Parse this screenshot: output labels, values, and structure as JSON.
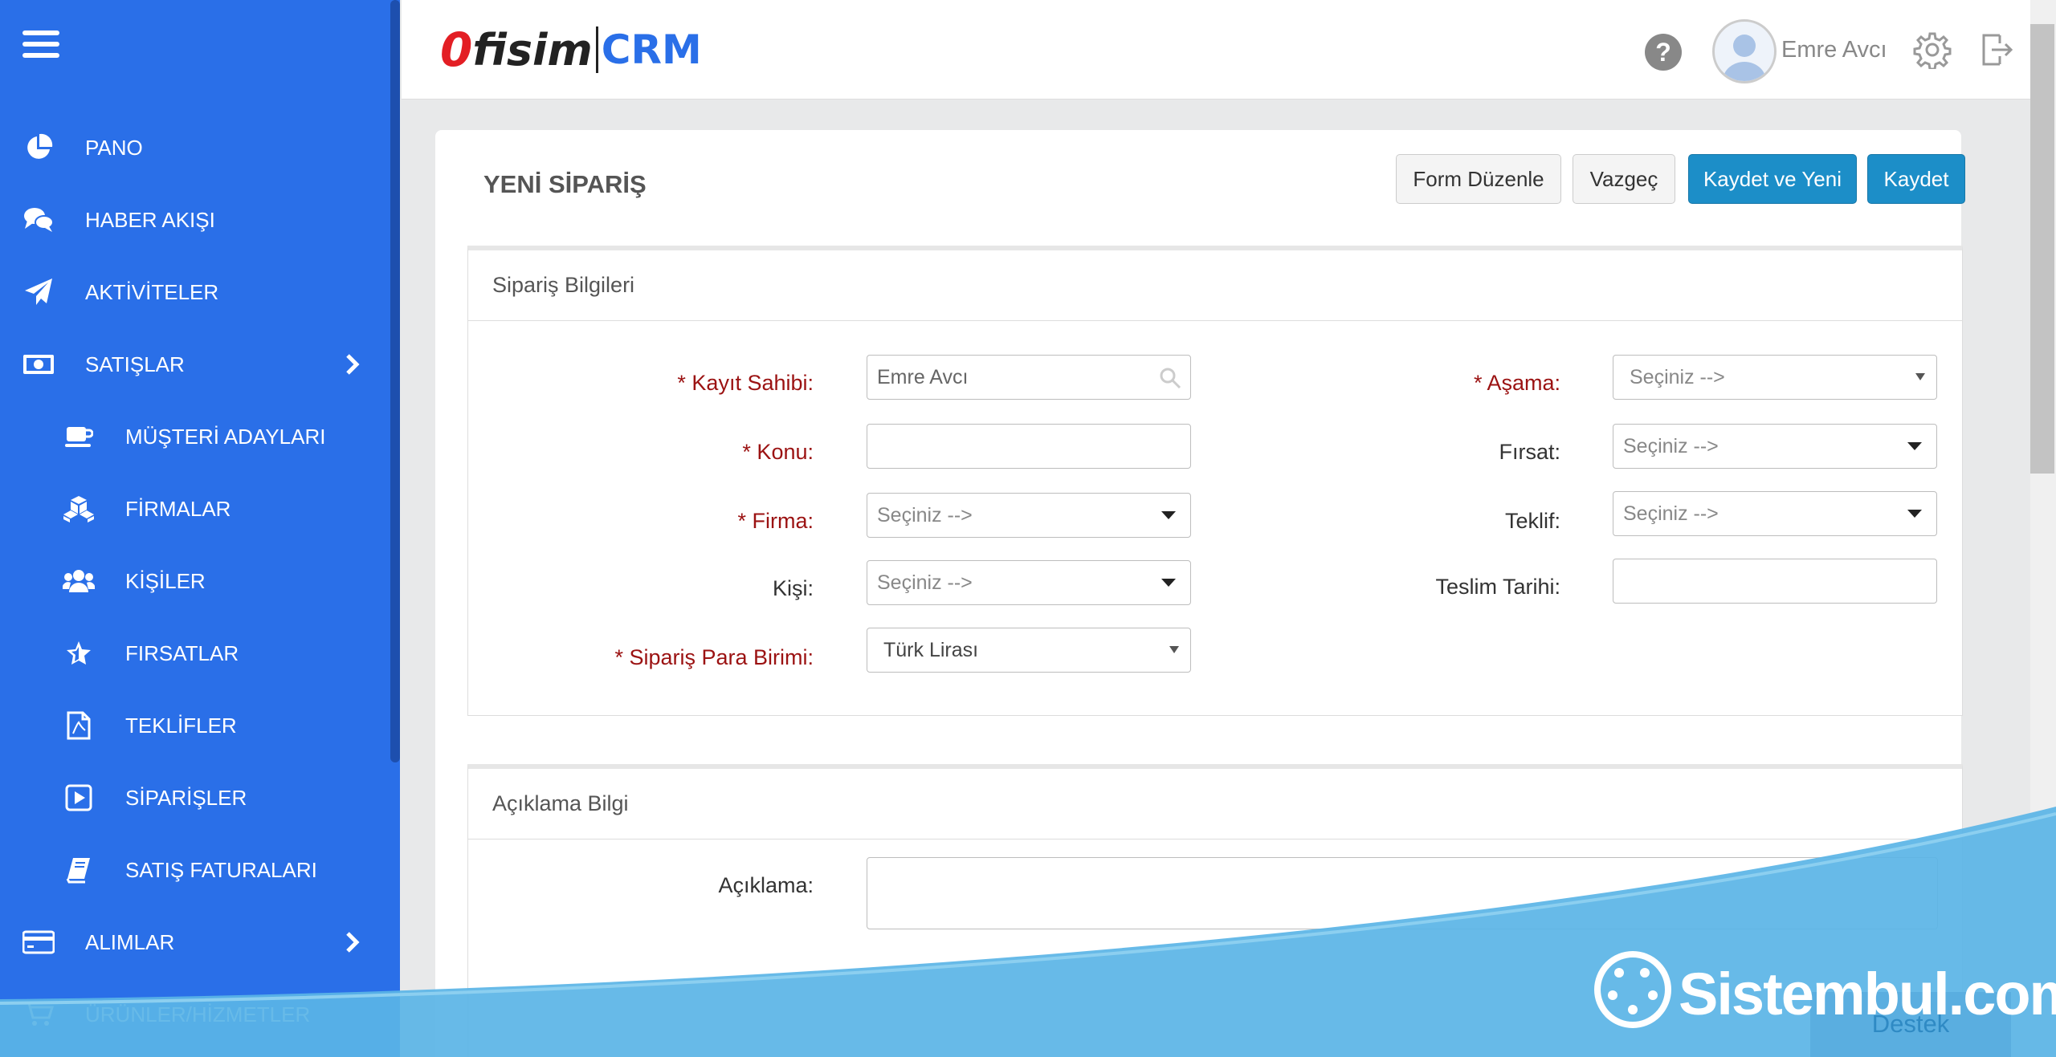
{
  "sidebar": {
    "items": [
      {
        "label": "PANO",
        "icon": "pie-chart-icon"
      },
      {
        "label": "HABER AKIŞI",
        "icon": "chat-icon"
      },
      {
        "label": "AKTİVİTELER",
        "icon": "paper-plane-icon"
      },
      {
        "label": "SATIŞLAR",
        "icon": "money-icon"
      },
      {
        "label": "MÜŞTERİ ADAYLARI",
        "icon": "coffee-icon"
      },
      {
        "label": "FİRMALAR",
        "icon": "cubes-icon"
      },
      {
        "label": "KİŞİLER",
        "icon": "users-icon"
      },
      {
        "label": "FIRSATLAR",
        "icon": "star-icon"
      },
      {
        "label": "TEKLİFLER",
        "icon": "pdf-file-icon"
      },
      {
        "label": "SİPARİŞLER",
        "icon": "play-square-icon"
      },
      {
        "label": "SATIŞ FATURALARI",
        "icon": "book-icon"
      },
      {
        "label": "ALIMLAR",
        "icon": "credit-card-icon"
      },
      {
        "label": "ÜRÜNLER/HİZMETLER",
        "icon": "cart-icon"
      }
    ]
  },
  "header": {
    "logo_part1": "0",
    "logo_part2": "fisim",
    "logo_part3": "CRM",
    "user_name": "Emre Avcı"
  },
  "page": {
    "title": "YENİ SİPARİŞ",
    "buttons": {
      "form_edit": "Form Düzenle",
      "cancel": "Vazgeç",
      "save_new": "Kaydet ve Yeni",
      "save": "Kaydet"
    }
  },
  "order_info": {
    "heading": "Sipariş Bilgileri",
    "owner_label": "* Kayıt Sahibi:",
    "owner_value": "Emre Avcı",
    "subject_label": "* Konu:",
    "company_label": "* Firma:",
    "company_placeholder": "Seçiniz -->",
    "person_label": "Kişi:",
    "person_placeholder": "Seçiniz -->",
    "currency_label": "* Sipariş Para Birimi:",
    "currency_value": "Türk Lirası",
    "stage_label": "* Aşama:",
    "stage_placeholder": "Seçiniz -->",
    "opportunity_label": "Fırsat:",
    "opportunity_placeholder": "Seçiniz -->",
    "offer_label": "Teklif:",
    "offer_placeholder": "Seçiniz -->",
    "delivery_label": "Teslim Tarihi:"
  },
  "description": {
    "heading": "Açıklama Bilgi",
    "label": "Açıklama:"
  },
  "watermark": {
    "text": "Sistembul.com",
    "destek": "Destek"
  },
  "colors": {
    "sidebar": "#2a6fe8",
    "primary_button": "#1c8ec8",
    "required_label": "#9b1212",
    "watermark_wave": "#5ab4e6"
  }
}
